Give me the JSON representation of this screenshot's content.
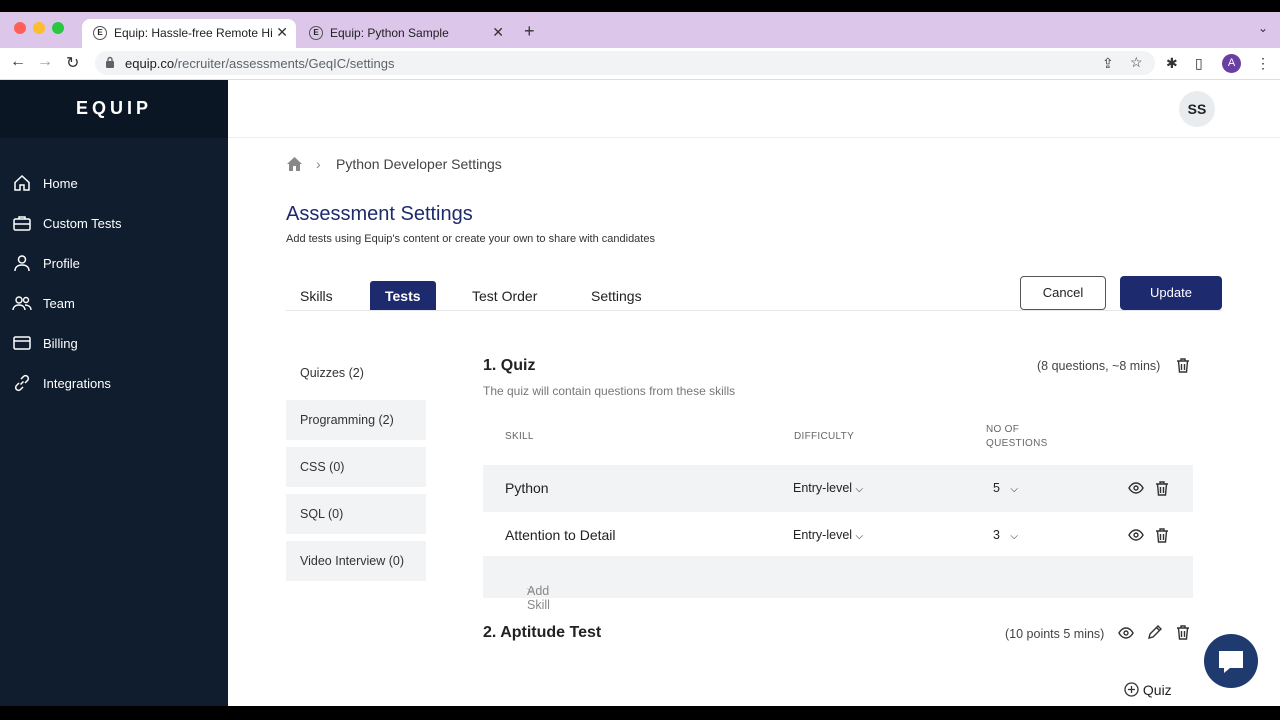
{
  "browser": {
    "tabs": [
      {
        "title": "Equip: Hassle-free Remote Hiri",
        "favicon": "E"
      },
      {
        "title": "Equip: Python Sample",
        "favicon": "E"
      }
    ],
    "url_host": "equip.co",
    "url_path": "/recruiter/assessments/GeqIC/settings",
    "profile_initial": "A"
  },
  "sidebar": {
    "logo": "EQUIP",
    "items": [
      {
        "label": "Home",
        "icon": "home-icon"
      },
      {
        "label": "Custom Tests",
        "icon": "briefcase-icon"
      },
      {
        "label": "Profile",
        "icon": "user-icon"
      },
      {
        "label": "Team",
        "icon": "team-icon"
      },
      {
        "label": "Billing",
        "icon": "card-icon"
      },
      {
        "label": "Integrations",
        "icon": "link-icon"
      }
    ]
  },
  "header": {
    "avatar": "SS"
  },
  "breadcrumb": {
    "current": "Python Developer Settings"
  },
  "page": {
    "title": "Assessment Settings",
    "subtitle": "Add tests using Equip's content or create your own to share with candidates"
  },
  "tabs": [
    "Skills",
    "Tests",
    "Test Order",
    "Settings"
  ],
  "active_tab": "Tests",
  "actions": {
    "cancel": "Cancel",
    "update": "Update"
  },
  "categories": [
    "Quizzes (2)",
    "Programming (2)",
    "CSS (0)",
    "SQL (0)",
    "Video Interview (0)"
  ],
  "quiz": {
    "title": "1. Quiz",
    "meta": "(8 questions, ~8 mins)",
    "description": "The quiz will contain questions from these skills",
    "columns": {
      "skill": "SKILL",
      "difficulty": "DIFFICULTY",
      "questions_1": "NO OF",
      "questions_2": "QUESTIONS"
    },
    "rows": [
      {
        "skill": "Python",
        "difficulty": "Entry-level",
        "questions": "5"
      },
      {
        "skill": "Attention to Detail",
        "difficulty": "Entry-level",
        "questions": "3"
      }
    ],
    "add_skill": "Add Skill"
  },
  "aptitude": {
    "title": "2. Aptitude Test",
    "meta": "(10 points 5 mins)"
  },
  "add_quiz": "Quiz",
  "colors": {
    "navy": "#1e2a6e",
    "sidebar": "#0f1d2e",
    "tabbar": "#dcc6ea"
  }
}
